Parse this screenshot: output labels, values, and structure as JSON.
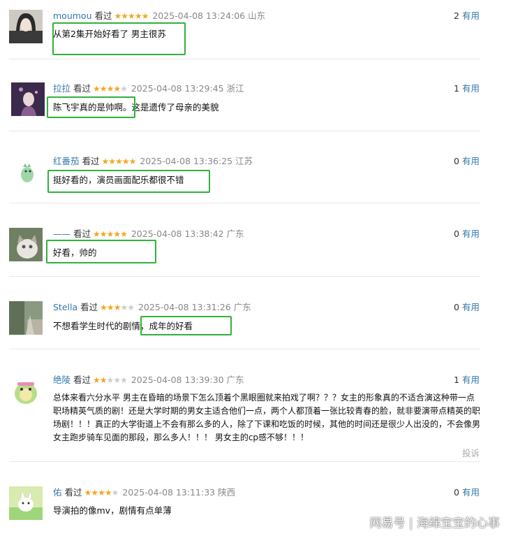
{
  "reviews": [
    {
      "user": "moumou",
      "watched": "看过",
      "stars": 5,
      "time": "2025-04-08 13:24:06",
      "location": "山东",
      "useful_count": "2",
      "useful_label": "有用",
      "content": "从第2集开始好看了 男主很苏"
    },
    {
      "user": "拉拉",
      "watched": "看过",
      "stars": 4,
      "time": "2025-04-08 13:29:45",
      "location": "浙江",
      "useful_count": "1",
      "useful_label": "有用",
      "content": "陈飞宇真的是帅啊。这是遗传了母亲的美貌"
    },
    {
      "user": "红番茄",
      "watched": "看过",
      "stars": 5,
      "time": "2025-04-08 13:36:25",
      "location": "江苏",
      "useful_count": "0",
      "useful_label": "有用",
      "content": "挺好看的，演员画面配乐都很不错"
    },
    {
      "user": "——",
      "watched": "看过",
      "stars": 5,
      "time": "2025-04-08 13:38:42",
      "location": "广东",
      "useful_count": "0",
      "useful_label": "有用",
      "content": "好看，帅的"
    },
    {
      "user": "Stella",
      "watched": "看过",
      "stars": 3,
      "time": "2025-04-08 13:31:26",
      "location": "广东",
      "useful_count": "0",
      "useful_label": "有用",
      "content": "不想看学生时代的剧情，成年的好看"
    },
    {
      "user": "绝陵",
      "watched": "看过",
      "stars": 2,
      "time": "2025-04-08 13:39:30",
      "location": "广东",
      "useful_count": "1",
      "useful_label": "有用",
      "content": "总体来看六分水平 男主在昏暗的场景下怎么顶着个黑眼圈就来拍戏了啊？？？女主的形象真的不适合演这种带一点职场精英气质的剧！还是大学时期的男女主适合他们一点，两个人都顶着一张比较青春的脸，就非要演带点精英的职场剧！！！真正的大学街道上不会有那么多的人，除了下课和吃饭的时候，其他的时间还是很少人出没的，不会像男女主跑步骑车见面的那段，那么多人！！！ 男女主的cp感不够！！！",
      "report": "投诉"
    },
    {
      "user": "佑",
      "watched": "看过",
      "stars": 4,
      "time": "2025-04-08 13:11:33",
      "location": "陕西",
      "useful_count": "0",
      "useful_label": "有用",
      "content": "导演拍的像mv，剧情有点单薄"
    }
  ],
  "watermark": "网易号 | 海绵宝宝的心事",
  "colors": {
    "link": "#3377aa",
    "star": "#f5a623",
    "highlight": "#2fb33b"
  }
}
